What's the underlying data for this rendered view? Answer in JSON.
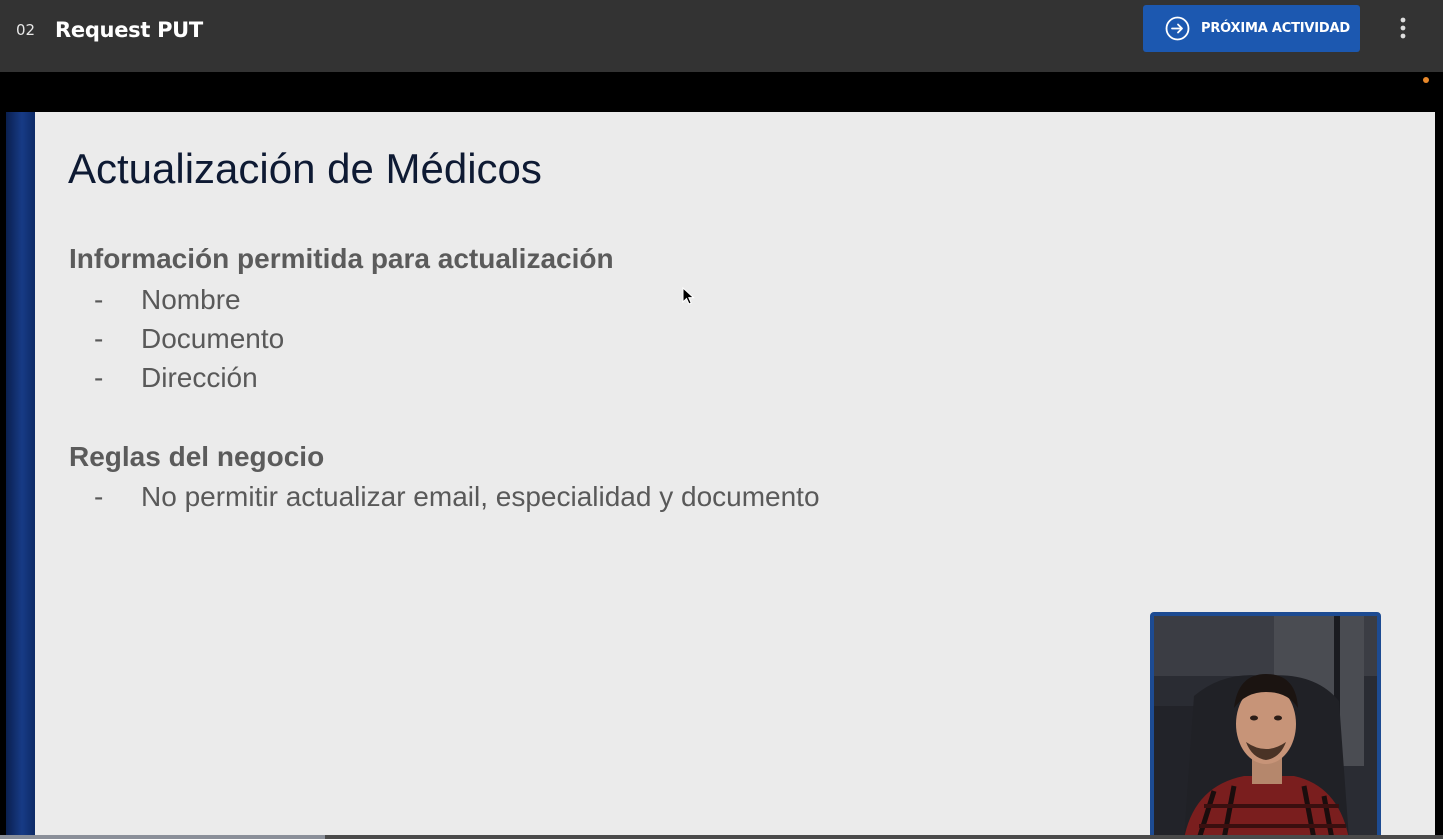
{
  "header": {
    "lesson_number": "02",
    "lesson_title": "Request PUT",
    "next_button_label": "PRÓXIMA ACTIVIDAD",
    "next_icon": "arrow-circle-right-icon",
    "more_icon": "more-vertical-icon"
  },
  "slide": {
    "title": "Actualización de Médicos",
    "sections": [
      {
        "heading": "Información permitida para actualización",
        "items": [
          "Nombre",
          "Documento",
          "Dirección"
        ]
      },
      {
        "heading": "Reglas del negocio",
        "items": [
          "No permitir actualizar email, especialidad y documento"
        ]
      }
    ],
    "bullet_char": "-"
  },
  "player": {
    "progress_fraction": 0.225
  },
  "colors": {
    "topbar": "#333333",
    "accent_button": "#1c58b0",
    "slide_background": "#ebebeb",
    "slide_sidebar": "#173b86",
    "title_text": "#0e1a33",
    "body_text": "#595959",
    "webcam_border": "#1d4b92"
  }
}
